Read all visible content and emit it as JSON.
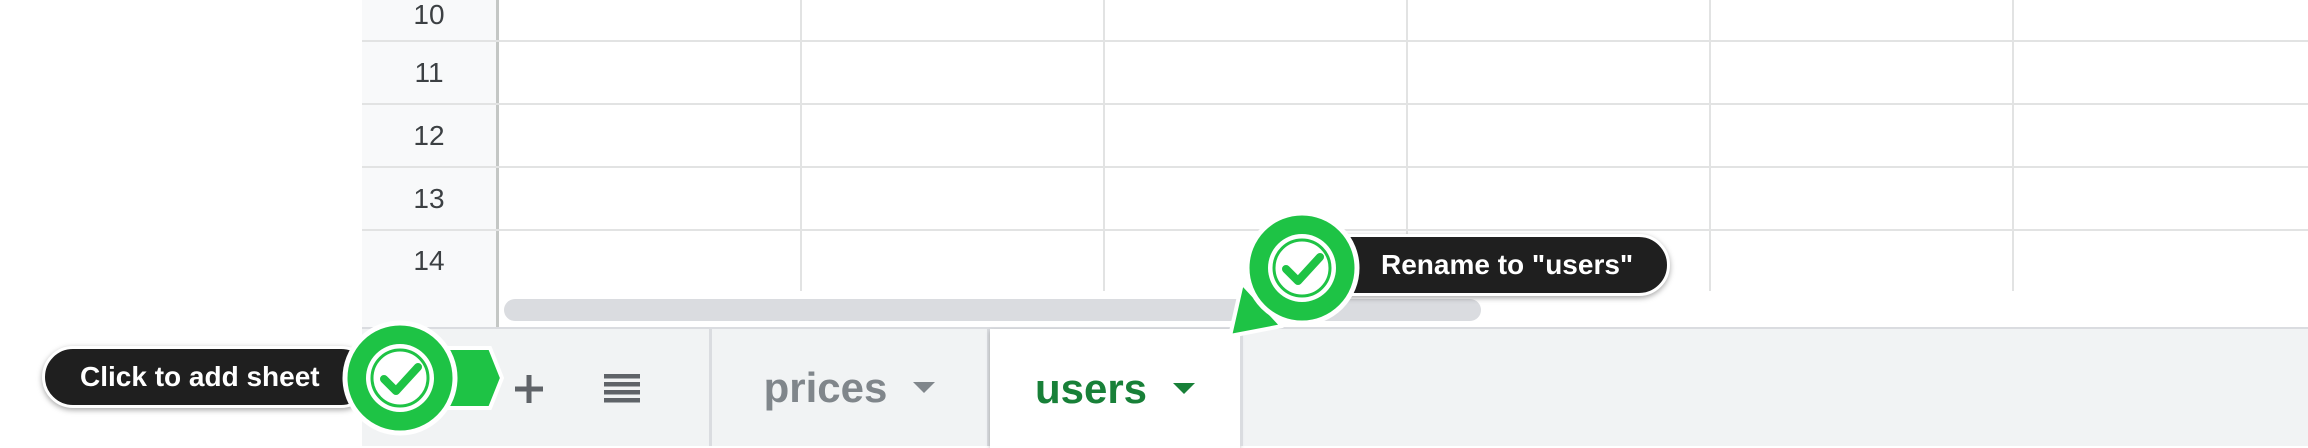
{
  "grid": {
    "rows": [
      "10",
      "11",
      "12",
      "13",
      "14"
    ]
  },
  "sheet_tabs": [
    {
      "name": "prices",
      "active": false
    },
    {
      "name": "users",
      "active": true
    }
  ],
  "toolbar": {
    "add_icon": "plus-icon",
    "list_icon": "sheet-list-icon"
  },
  "annotations": {
    "add_sheet": {
      "label": "Click to add sheet",
      "icon": "checkmark-icon"
    },
    "rename": {
      "label": "Rename to \"users\"",
      "icon": "checkmark-icon"
    }
  },
  "colors": {
    "annotation_green": "#1ec345",
    "active_tab_text": "#188038",
    "inactive_tab_text": "#80868b",
    "pill_background": "#1f1f1f"
  }
}
